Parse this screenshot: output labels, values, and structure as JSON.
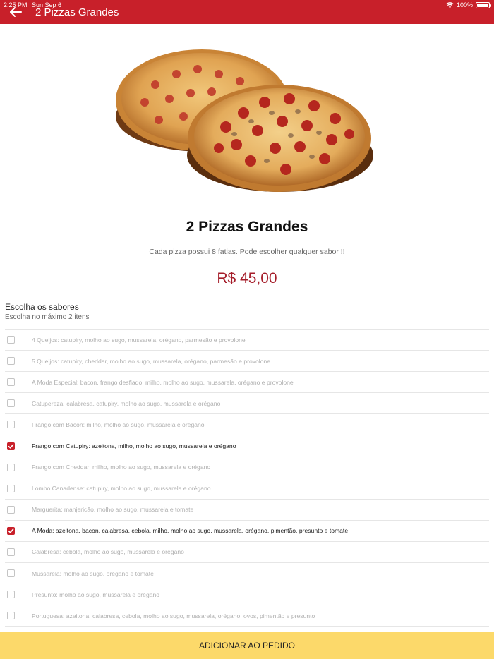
{
  "status_bar": {
    "time": "2:25 PM",
    "date": "Sun Sep 6",
    "battery": "100%"
  },
  "header": {
    "title": "2 Pizzas Grandes",
    "back_icon": "arrow-left-icon"
  },
  "product": {
    "title": "2 Pizzas Grandes",
    "description": "Cada pizza possui 8 fatias. Pode escolher qualquer sabor !!",
    "price": "R$ 45,00"
  },
  "flavors": {
    "title": "Escolha os sabores",
    "subtitle": "Escolha no máximo 2 itens",
    "items": [
      {
        "label": "4 Queijos: catupiry, molho ao sugo, mussarela, orégano, parmesão e provolone",
        "checked": false
      },
      {
        "label": "5 Queijos: catupiry, cheddar, molho ao sugo, mussarela, orégano, parmesão e provolone",
        "checked": false
      },
      {
        "label": "A Moda Especial: bacon, frango desfiado, milho, molho ao sugo, mussarela, orégano e provolone",
        "checked": false
      },
      {
        "label": "Catupereza: calabresa, catupiry, molho ao sugo, mussarela e orégano",
        "checked": false
      },
      {
        "label": "Frango com Bacon: milho, molho ao sugo, mussarela e orégano",
        "checked": false
      },
      {
        "label": "Frango com Catupiry: azeitona, milho, molho ao sugo, mussarela e orégano",
        "checked": true
      },
      {
        "label": "Frango com Cheddar: milho, molho ao sugo, mussarela e orégano",
        "checked": false
      },
      {
        "label": "Lombo Canadense: catupiry, molho ao sugo, mussarela e orégano",
        "checked": false
      },
      {
        "label": "Marguerita: manjericão, molho ao sugo, mussarela e tomate",
        "checked": false
      },
      {
        "label": "A Moda: azeitona, bacon, calabresa, cebola, milho, molho ao sugo, mussarela, orégano, pimentão, presunto e tomate",
        "checked": true
      },
      {
        "label": "Calabresa: cebola, molho ao sugo, mussarela e orégano",
        "checked": false
      },
      {
        "label": "Mussarela: molho ao sugo, orégano e tomate",
        "checked": false
      },
      {
        "label": "Presunto: molho ao sugo, mussarela e orégano",
        "checked": false
      },
      {
        "label": "Portuguesa: azeitona, calabresa, cebola, molho ao sugo, mussarela, orégano, ovos, pimentão e presunto",
        "checked": false
      }
    ]
  },
  "add_button": {
    "label": "ADICIONAR AO PEDIDO"
  },
  "colors": {
    "header": "#c8202a",
    "price": "#a51d2a",
    "add_button": "#fcd96a",
    "checked": "#c8202a"
  }
}
